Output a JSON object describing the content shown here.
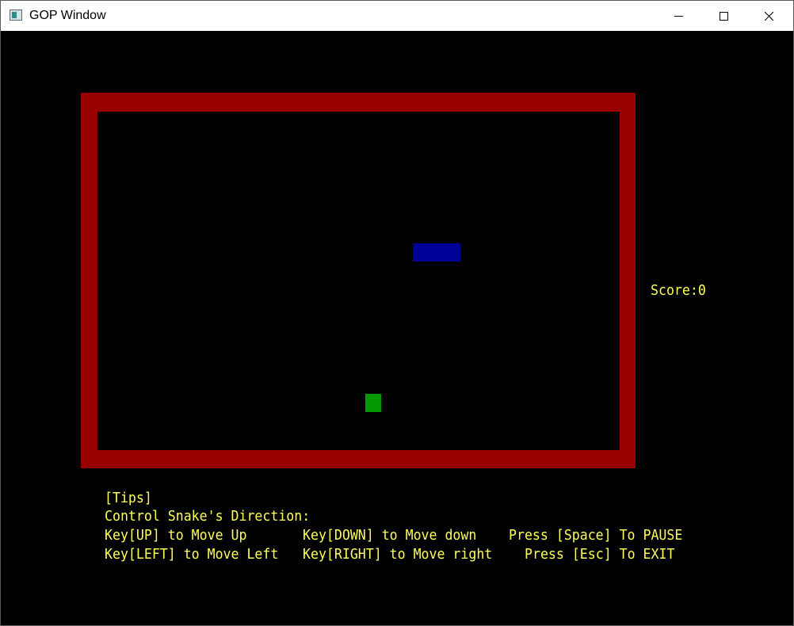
{
  "window": {
    "title": "GOP Window",
    "icon": "app-window-icon"
  },
  "colors": {
    "background": "#000000",
    "border": "#990000",
    "snake": "#000099",
    "food": "#009900",
    "text": "#ffff55"
  },
  "game": {
    "score_label": "Score:0",
    "score": 0
  },
  "tips": {
    "header": "[Tips]",
    "subtitle": "Control Snake's Direction:",
    "up": "Key[UP] to Move Up",
    "down": "Key[DOWN] to Move down",
    "pause": "Press [Space] To PAUSE",
    "left": "Key[LEFT] to Move Left",
    "right": "Key[RIGHT] to Move right",
    "exit": "Press [Esc] To EXIT"
  }
}
